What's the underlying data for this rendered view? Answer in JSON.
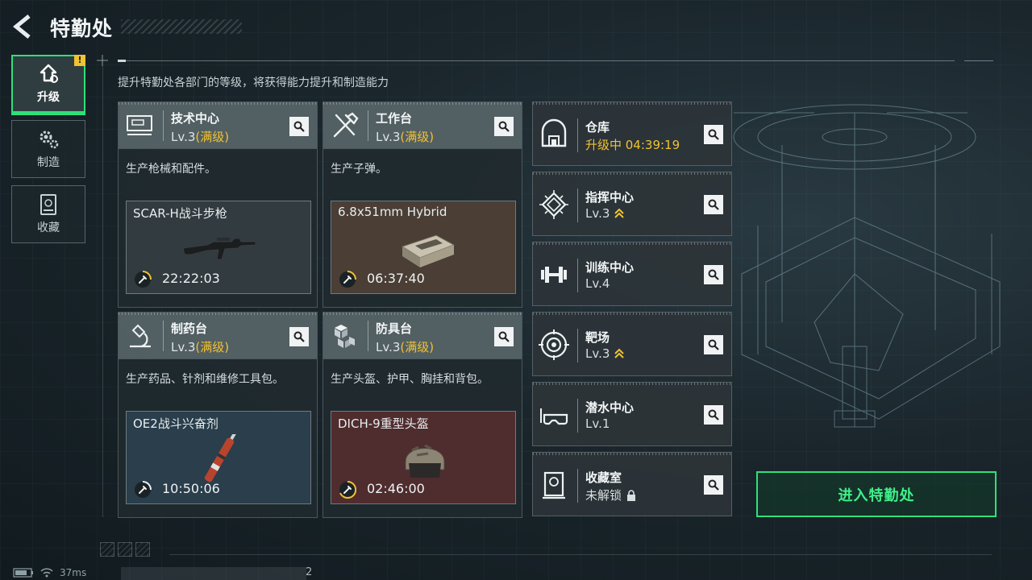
{
  "header": {
    "title": "特勤处",
    "back_icon": "back-arrow-icon",
    "description": "提升特勤处各部门的等级，将获得能力提升和制造能力"
  },
  "nav": {
    "items": [
      {
        "label": "升级",
        "icon": "upgrade-icon",
        "active": true,
        "badge": "!"
      },
      {
        "label": "制造",
        "icon": "gear-icon",
        "active": false
      },
      {
        "label": "收藏",
        "icon": "collection-icon",
        "active": false
      }
    ]
  },
  "cards": [
    {
      "name": "技术中心",
      "level": "Lv.3",
      "level_tag": "(满级)",
      "icon": "computer-icon",
      "desc": "生产枪械和配件。",
      "product": {
        "name": "SCAR-H战斗步枪",
        "timer": "22:22:03",
        "tint": "gray",
        "image": "rifle-image"
      }
    },
    {
      "name": "工作台",
      "level": "Lv.3",
      "level_tag": "(满级)",
      "icon": "tools-icon",
      "desc": "生产子弹。",
      "product": {
        "name": "6.8x51mm Hybrid",
        "timer": "06:37:40",
        "tint": "brown",
        "image": "ammo-box-image"
      }
    },
    {
      "name": "制药台",
      "level": "Lv.3",
      "level_tag": "(满级)",
      "icon": "microscope-icon",
      "desc": "生产药品、针剂和维修工具包。",
      "product": {
        "name": "OE2战斗兴奋剂",
        "timer": "10:50:06",
        "tint": "blue",
        "image": "injector-image"
      }
    },
    {
      "name": "防具台",
      "level": "Lv.3",
      "level_tag": "(满级)",
      "icon": "armor-cubes-icon",
      "desc": "生产头盔、护甲、胸挂和背包。",
      "product": {
        "name": "DICH-9重型头盔",
        "timer": "02:46:00",
        "tint": "red",
        "image": "helmet-image"
      }
    }
  ],
  "facilities": [
    {
      "name": "仓库",
      "sub": "升级中 04:39:19",
      "state": "upgrading",
      "icon": "warehouse-icon"
    },
    {
      "name": "指挥中心",
      "sub": "Lv.3",
      "state": "upgradable",
      "icon": "chip-icon"
    },
    {
      "name": "训练中心",
      "sub": "Lv.4",
      "state": "normal",
      "icon": "dumbbell-icon"
    },
    {
      "name": "靶场",
      "sub": "Lv.3",
      "state": "upgradable",
      "icon": "target-icon"
    },
    {
      "name": "潜水中心",
      "sub": "Lv.1",
      "state": "normal",
      "icon": "diving-mask-icon"
    },
    {
      "name": "收藏室",
      "sub": "未解锁",
      "state": "locked",
      "icon": "collection-room-icon"
    }
  ],
  "enter_button": "进入特勤处",
  "status": {
    "ping": "37ms",
    "number": "2"
  },
  "colors": {
    "accent_green": "#2fe07a",
    "max_level_gold": "#f1c232"
  }
}
